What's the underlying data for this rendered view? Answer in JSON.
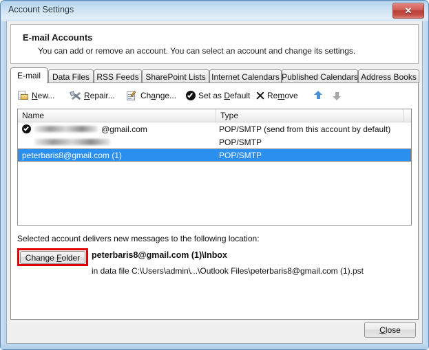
{
  "window": {
    "title": "Account Settings",
    "close_button_glyph": "✕"
  },
  "header": {
    "title": "E-mail Accounts",
    "subtitle": "You can add or remove an account. You can select an account and change its settings."
  },
  "tabs": [
    {
      "label": "E-mail",
      "active": true
    },
    {
      "label": "Data Files",
      "active": false
    },
    {
      "label": "RSS Feeds",
      "active": false
    },
    {
      "label": "SharePoint Lists",
      "active": false
    },
    {
      "label": "Internet Calendars",
      "active": false
    },
    {
      "label": "Published Calendars",
      "active": false
    },
    {
      "label": "Address Books",
      "active": false
    }
  ],
  "toolbar": {
    "new_label": "New...",
    "new_accesskey": "N",
    "repair_label": "Repair...",
    "repair_accesskey": "R",
    "change_label": "Change...",
    "change_accesskey": "a",
    "set_default_label": "Set as Default",
    "set_default_accesskey": "D",
    "remove_label": "Remove",
    "remove_accesskey": "m",
    "move_up_label": "Move Up",
    "move_down_label": "Move Down"
  },
  "accounts_list": {
    "columns": [
      "Name",
      "Type"
    ],
    "rows": [
      {
        "name": "@gmail.com",
        "name_redacted_prefix": true,
        "is_default": true,
        "type": "POP/SMTP (send from this account by default)",
        "selected": false
      },
      {
        "name": "",
        "name_redacted_prefix": true,
        "is_default": false,
        "type": "POP/SMTP",
        "selected": false
      },
      {
        "name": "peterbaris8@gmail.com (1)",
        "name_redacted_prefix": false,
        "is_default": false,
        "type": "POP/SMTP",
        "selected": true
      }
    ]
  },
  "delivery": {
    "label": "Selected account delivers new messages to the following location:",
    "change_folder_label": "Change Folder",
    "change_folder_accesskey": "F",
    "folder": "peterbaris8@gmail.com (1)\\Inbox",
    "data_file": "in data file C:\\Users\\admin\\...\\Outlook Files\\peterbaris8@gmail.com (1).pst",
    "highlight_color": "#e00000"
  },
  "footer": {
    "close_label": "Close",
    "close_accesskey": "C"
  },
  "colors": {
    "selection_blue": "#2a8fef",
    "title_bar": "#cfe4f5",
    "accent_arrow_up": "#4a90d9"
  }
}
